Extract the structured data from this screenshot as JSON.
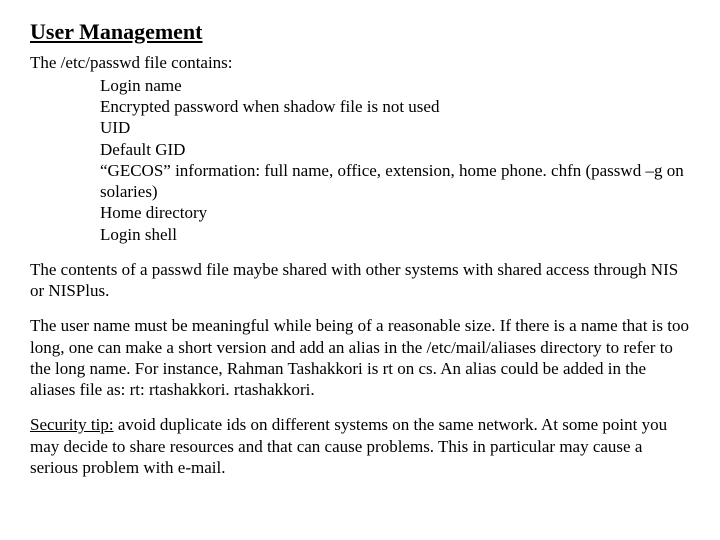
{
  "heading": "User Management",
  "intro": "The /etc/passwd file contains:",
  "fields": [
    "Login name",
    "Encrypted password when shadow file is not used",
    "UID",
    "Default GID",
    "“GECOS” information: full name, office, extension, home phone. chfn (passwd –g on solaries)",
    "Home directory",
    "Login shell"
  ],
  "para1": "The contents of a passwd file maybe shared with other systems with shared access through NIS or NISPlus.",
  "para2": "The user name must be meaningful while being of a reasonable size.  If there is a name that is too long, one can make a short version and add an alias in the /etc/mail/aliases directory to refer to the long name.  For instance, Rahman Tashakkori is rt on cs.  An alias could be added in the aliases file as:  rt: rtashakkori.  rtashakkori.",
  "security_label": "Security tip:",
  "security_text": " avoid duplicate ids on different systems on the same network.  At some point you may decide to share resources and that can cause problems.  This in particular may cause a serious problem with e-mail."
}
